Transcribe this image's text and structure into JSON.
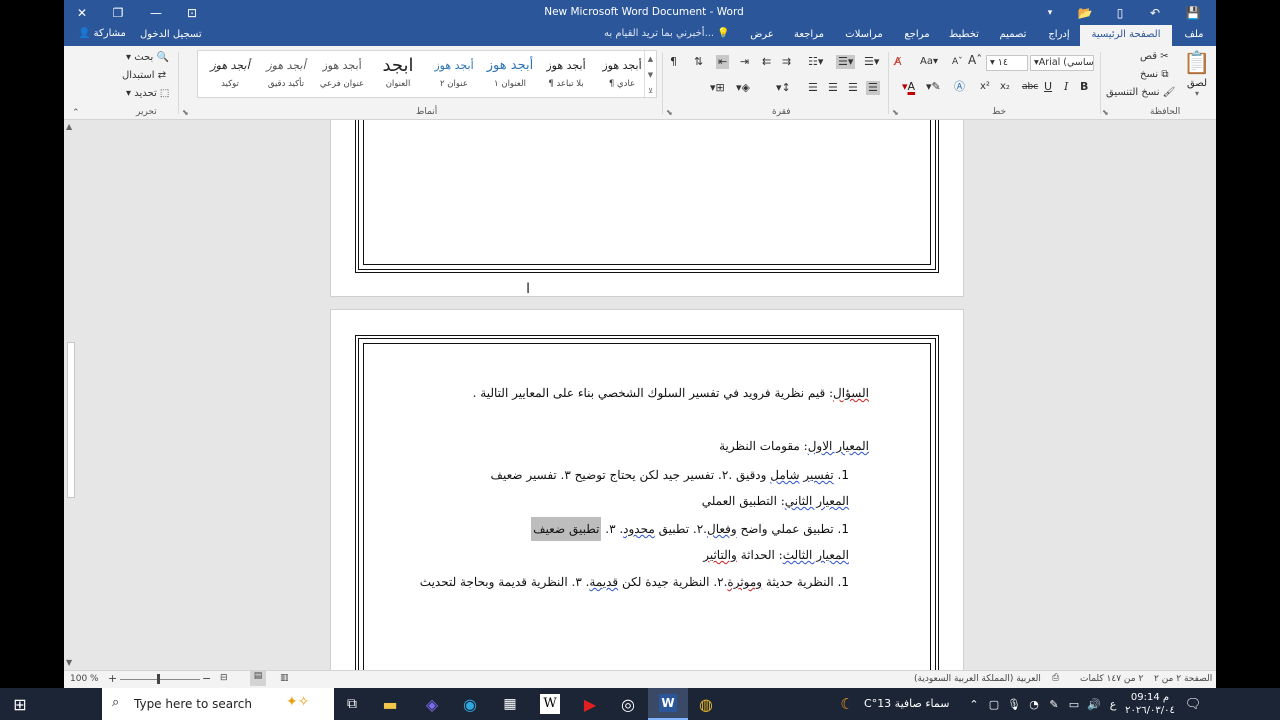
{
  "window": {
    "title": "New Microsoft Word Document - Word"
  },
  "tabs": [
    {
      "label": "ملف",
      "active": false
    },
    {
      "label": "الصفحة الرئيسية",
      "active": true
    },
    {
      "label": "إدراج",
      "active": false
    },
    {
      "label": "تصميم",
      "active": false
    },
    {
      "label": "تخطيط",
      "active": false
    },
    {
      "label": "مراجع",
      "active": false
    },
    {
      "label": "مراسلات",
      "active": false
    },
    {
      "label": "مراجعة",
      "active": false
    },
    {
      "label": "عرض",
      "active": false
    }
  ],
  "tell_me": "أخبرني بما تريد القيام به...",
  "account": {
    "signin": "تسجيل الدخول",
    "share": "مشاركة"
  },
  "clipboard": {
    "group": "الحافظة",
    "paste": "لصق",
    "cut": "قص",
    "copy": "نسخ",
    "format_painter": "نسخ التنسيق"
  },
  "font": {
    "group": "خط",
    "name": "Arial (أساسي)",
    "size": "١٤",
    "grow": "A",
    "shrink": "A",
    "case": "Aa",
    "bold": "B",
    "italic": "I",
    "underline": "U",
    "strike": "abc",
    "subscript": "x₂",
    "superscript": "x²"
  },
  "paragraph": {
    "group": "فقرة"
  },
  "styles": {
    "group": "أنماط",
    "items": [
      {
        "preview": "أبجد هوز",
        "name": "¶ عادي"
      },
      {
        "preview": "أبجد هوز",
        "name": "¶ بلا تباعد"
      },
      {
        "preview": "أبجد هوز",
        "name": "العنوان ١"
      },
      {
        "preview": "أبجد هوز",
        "name": "عنوان ٢"
      },
      {
        "preview": "ابجد",
        "name": "العنوان"
      },
      {
        "preview": "أبجد هوز",
        "name": "عنوان فرعي"
      },
      {
        "preview": "أبجد هوز",
        "name": "تأكيد دقيق"
      },
      {
        "preview": "أبجد هوز",
        "name": "توكيد"
      }
    ]
  },
  "editing": {
    "group": "تحرير",
    "find": "بحث",
    "replace": "استبدال",
    "select": "تحديد"
  },
  "document": {
    "question_label": "السؤال",
    "question_text": ": قيم نظرية فرويد في تفسير السلوك الشخصي بناء على المعايير التالية .",
    "c1_label": "المعيار الاول",
    "c1_text": ": مقومات النظرية",
    "c1_item_num": "1.",
    "c1_item_a": "تفسير",
    "c1_item_b": "شامل",
    "c1_item_c": "ودقيق .٢. تفسير جيد لكن يحتاج توضيح ٣. تفسير ضعيف",
    "c2_label": "المعيار الثاني",
    "c2_text": ": التطبيق العملي",
    "c2_item_num": "1.",
    "c2_item_a": "تطبيق عملي واضح",
    "c2_item_b": "وفعال",
    "c2_item_c": ".٢. تطبيق",
    "c2_item_d": "محدود",
    "c2_item_e": ". ٣.",
    "c2_item_sel": "تطبيق ضعيف",
    "c3_label": "المعيار الثالث",
    "c3_text": ": الحداثة",
    "c3_text_b": "والتاثير",
    "c3_item_num": "1.",
    "c3_item_a": "النظرية حديثة",
    "c3_item_b": "وموثرة",
    "c3_item_c": ".٢. النظرية جيدة لكن",
    "c3_item_d": "قديمة",
    "c3_item_e": ". ٣. النظرية قديمة وبحاجة لتحديث"
  },
  "status": {
    "page": "الصفحة ٢ من ٢",
    "words": "٢ من ١٤٧ كلمات",
    "language": "العربية (المملكة العربية السعودية)",
    "zoom": "100 %"
  },
  "taskbar": {
    "search_placeholder": "Type here to search",
    "weather": "سماء صافية 13°C",
    "time": "09:14 م",
    "date": "٢٠٢٦/٠٣/٠٤",
    "input_lang": "ع"
  }
}
